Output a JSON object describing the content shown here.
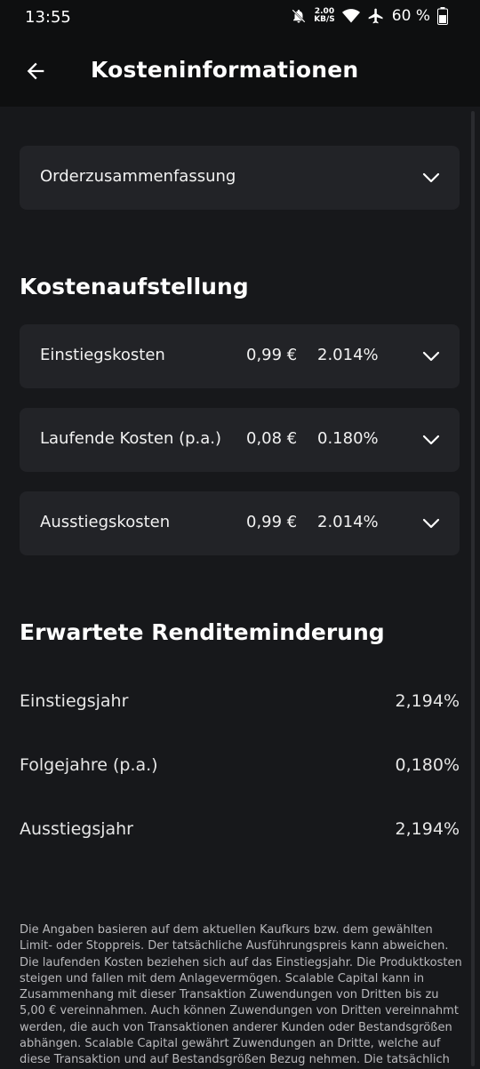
{
  "status": {
    "time": "13:55",
    "net_speed_top": "2.00",
    "net_speed_bottom": "KB/S",
    "battery": "60 %"
  },
  "header": {
    "title": "Kosteninformationen"
  },
  "order_summary": {
    "label": "Orderzusammenfassung"
  },
  "cost_breakdown": {
    "title": "Kostenaufstellung",
    "items": [
      {
        "label": "Einstiegskosten",
        "amount": "0,99 €",
        "percent": "2.014%"
      },
      {
        "label": "Laufende Kosten (p.a.)",
        "amount": "0,08 €",
        "percent": "0.180%"
      },
      {
        "label": "Ausstiegskosten",
        "amount": "0,99 €",
        "percent": "2.014%"
      }
    ]
  },
  "return_reduction": {
    "title": "Erwartete Renditeminderung",
    "rows": [
      {
        "label": "Einstiegsjahr",
        "value": "2,194%"
      },
      {
        "label": "Folgejahre (p.a.)",
        "value": "0,180%"
      },
      {
        "label": "Ausstiegsjahr",
        "value": "2,194%"
      }
    ]
  },
  "footnote": "Die Angaben basieren auf dem aktuellen Kaufkurs bzw. dem gewählten Limit- oder Stoppreis. Der tatsächliche Ausführungspreis kann abweichen. Die laufenden Kosten beziehen sich auf das Einstiegsjahr. Die Produktkosten steigen und fallen mit dem Anlagevermögen. Scalable Capital kann in Zusammenhang mit dieser Transaktion Zuwendungen von Dritten bis zu 5,00 € vereinnahmen. Auch können Zuwendungen von Dritten vereinnahmt werden, die auch von Transaktionen anderer Kunden oder Bestandsgrößen abhängen. Scalable Capital gewährt Zuwendungen an Dritte, welche auf diese Transaktion und auf Bestandsgrößen Bezug nehmen. Die tatsächlich",
  "colors": {
    "background": "#17181b",
    "header_bg": "#0e0f10",
    "card_bg": "#222327",
    "text": "#ffffff",
    "muted_text": "#b9b9bc"
  },
  "icons": [
    "bell-off-icon",
    "wifi-icon",
    "airplane-icon",
    "battery-icon",
    "back-arrow-icon",
    "chevron-down-icon"
  ]
}
